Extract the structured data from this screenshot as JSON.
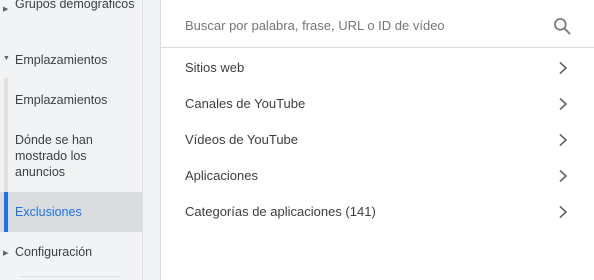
{
  "sidebar": {
    "groups_label": "Grupos demográficos",
    "placements_label": "Emplazamientos",
    "sub_items": [
      {
        "label": "Emplazamientos"
      },
      {
        "label": "Dónde se han mostrado los anuncios"
      },
      {
        "label": "Exclusiones"
      }
    ],
    "config_label": "Configuración"
  },
  "search": {
    "placeholder": "Buscar por palabra, frase, URL o ID de vídeo",
    "icon": "search-icon"
  },
  "categories": [
    {
      "label": "Sitios web"
    },
    {
      "label": "Canales de YouTube"
    },
    {
      "label": "Vídeos de YouTube"
    },
    {
      "label": "Aplicaciones"
    },
    {
      "label": "Categorías de aplicaciones (141)"
    }
  ],
  "colors": {
    "accent": "#1a73e8",
    "selected_bg": "#dadce0",
    "sidebar_bg": "#f1f3f4"
  }
}
